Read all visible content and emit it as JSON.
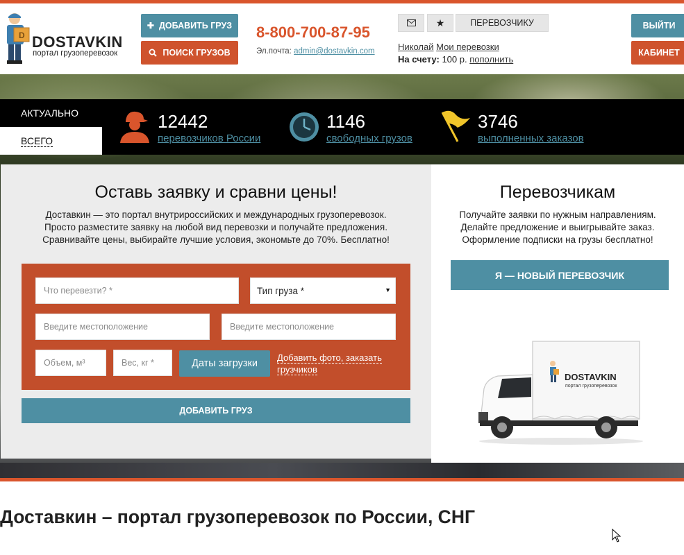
{
  "logo": {
    "name": "DOSTAVKIN",
    "tagline": "портал грузоперевозок",
    "icon": "mover-with-box-icon"
  },
  "header": {
    "add_cargo_label": "ДОБАВИТЬ ГРУЗ",
    "search_cargo_label": "ПОИСК ГРУЗОВ",
    "phone": "8-800-700-87-95",
    "email_label": "Эл.почта:",
    "email": "admin@dostavkin.com",
    "mail_icon": "envelope-icon",
    "star_icon": "star-icon",
    "carrier_label": "ПЕРЕВОЗЧИКУ",
    "user_name": "Николай",
    "my_transports": "Мои перевозки",
    "balance_label": "На счету:",
    "balance_value": "100 р.",
    "top_up": "пополнить",
    "logout_label": "ВЫЙТИ",
    "cabinet_label": "КАБИНЕТ"
  },
  "stats": {
    "tab_current": "АКТУАЛЬНО",
    "tab_all": "ВСЕГО",
    "items": [
      {
        "icon": "driver-icon",
        "number": "12442",
        "label": "перевозчиков России"
      },
      {
        "icon": "clock-icon",
        "number": "1146",
        "label": "свободных грузов"
      },
      {
        "icon": "flag-icon",
        "number": "3746",
        "label": "выполненных заказов"
      }
    ]
  },
  "request": {
    "title": "Оставь заявку и сравни цены!",
    "desc_lines": [
      "Доставкин — это портал внутрироссийских и международных грузоперевозок.",
      "Просто разместите заявку на любой вид перевозки и получайте предложения.",
      "Сравнивайте цены, выбирайте лучшие условия, экономьте до 70%. Бесплатно!"
    ],
    "what_placeholder": "Что перевезти? *",
    "cargo_type": "Тип груза *",
    "from_placeholder": "Введите местоположение",
    "to_placeholder": "Введите местоположение",
    "volume_placeholder": "Объем, м³",
    "weight_placeholder": "Вес, кг *",
    "dates_label": "Даты загрузки",
    "add_photo_link": "Добавить фото, заказать грузчиков",
    "submit_label": "ДОБАВИТЬ ГРУЗ"
  },
  "carriers": {
    "title": "Перевозчикам",
    "desc_lines": [
      "Получайте заявки по нужным направлениям.",
      "Делайте предложение и выигрывайте заказ.",
      "Оформление подписки на грузы бесплатно!"
    ],
    "button_label": "Я — НОВЫЙ ПЕРЕВОЗЧИК",
    "truck_brand": "DOSTAVKIN",
    "truck_tagline": "портал грузоперевозок"
  },
  "bottom_heading": "Доставкин – портал грузоперевозок по России, СНГ",
  "colors": {
    "orange": "#d9552c",
    "form_orange": "#c24e2b",
    "teal": "#4e8fa3",
    "black_bar": "#000000",
    "panel_gray": "#ececec"
  }
}
